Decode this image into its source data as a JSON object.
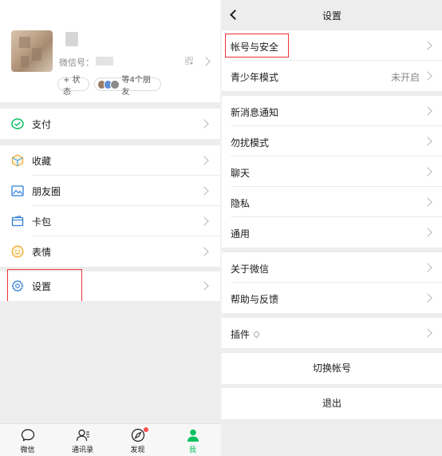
{
  "me": {
    "wechat_id_label": "微信号：",
    "status_chip": "+ 状态",
    "friends_chip": "等4个朋友",
    "menu": [
      {
        "label": "支付",
        "icon": "pay-icon"
      },
      {
        "label": "收藏",
        "icon": "favorites-icon"
      },
      {
        "label": "朋友圈",
        "icon": "moments-icon"
      },
      {
        "label": "卡包",
        "icon": "card-wallet-icon"
      },
      {
        "label": "表情",
        "icon": "sticker-icon"
      },
      {
        "label": "设置",
        "icon": "settings-gear-icon"
      }
    ]
  },
  "tabbar": {
    "items": [
      {
        "label": "微信"
      },
      {
        "label": "通讯录"
      },
      {
        "label": "发现"
      },
      {
        "label": "我"
      }
    ],
    "active": "我"
  },
  "settings": {
    "title": "设置",
    "items": [
      {
        "label": "帐号与安全"
      },
      {
        "label": "青少年模式",
        "value": "未开启"
      },
      {
        "label": "新消息通知"
      },
      {
        "label": "勿扰模式"
      },
      {
        "label": "聊天"
      },
      {
        "label": "隐私"
      },
      {
        "label": "通用"
      },
      {
        "label": "关于微信"
      },
      {
        "label": "帮助与反馈"
      },
      {
        "label": "插件"
      }
    ],
    "switch_account": "切换帐号",
    "logout": "退出"
  },
  "colors": {
    "accent": "#07c160",
    "highlight_box": "#e33333",
    "background": "#ededed"
  }
}
